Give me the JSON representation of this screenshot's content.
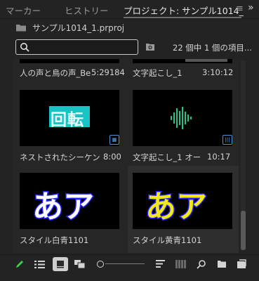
{
  "tabs": [
    {
      "label": "マーカー"
    },
    {
      "label": "ヒストリー"
    },
    {
      "label": "プロジェクト: サンプル1014_"
    }
  ],
  "tab_menu_glyph": "≡",
  "overflow_glyph": "»",
  "project": {
    "filename": "サンプル1014_1.prproj"
  },
  "search": {
    "value": "",
    "placeholder": ""
  },
  "item_count": "22 個中 1 個の項目...",
  "items": [
    {
      "name": "人の声と鳥の声_Be",
      "duration": "5:29184"
    },
    {
      "name": "文字起こし_1",
      "duration": "3:10:12"
    },
    {
      "name": "ネストされたシーケン",
      "duration": "8:00",
      "thumb_text": "回転"
    },
    {
      "name": "文字起こし_1 オー",
      "duration": "10:17"
    },
    {
      "name": "スタイル白青1101",
      "duration": "",
      "thumb_text": "あア"
    },
    {
      "name": "スタイル黄青1101",
      "duration": "",
      "thumb_text": "あア"
    }
  ],
  "colors": {
    "panel_bg": "#232323",
    "accent_blue": "#2d8ceb",
    "cyan": "#19c3c3",
    "waveform_green": "#21c28b",
    "yellow": "#f2e81a",
    "pencil_green": "#3ecf4f"
  },
  "bottom_toolbar": [
    "pencil-icon",
    "list-view-icon",
    "icon-view-icon",
    "freeform-view-icon",
    "zoom-slider",
    "sort-icon",
    "automate-icon",
    "find-icon",
    "new-bin-icon",
    "new-item-icon"
  ]
}
